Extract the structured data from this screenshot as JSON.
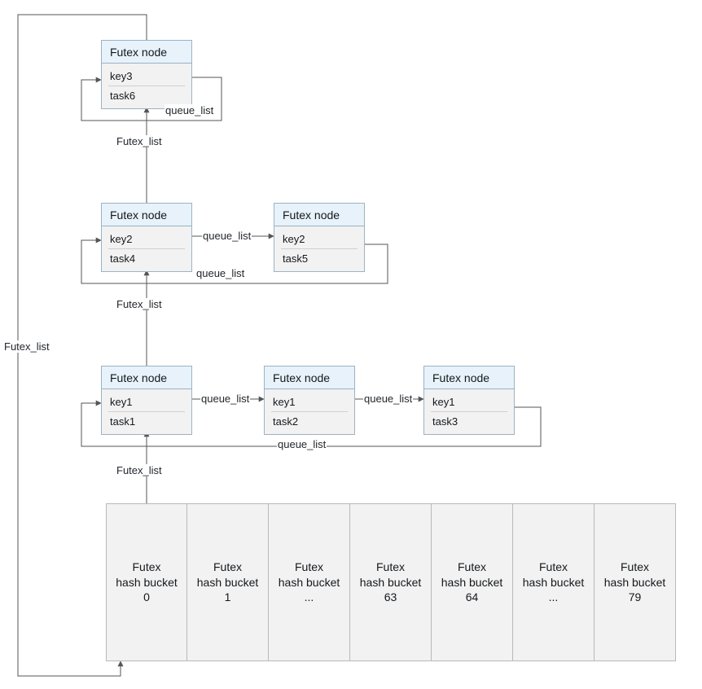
{
  "node_title": "Futex node",
  "nodes": {
    "n_k3_t6": {
      "key": "key3",
      "task": "task6"
    },
    "n_k2_t4": {
      "key": "key2",
      "task": "task4"
    },
    "n_k2_t5": {
      "key": "key2",
      "task": "task5"
    },
    "n_k1_t1": {
      "key": "key1",
      "task": "task1"
    },
    "n_k1_t2": {
      "key": "key1",
      "task": "task2"
    },
    "n_k1_t3": {
      "key": "key1",
      "task": "task3"
    }
  },
  "edge_labels": {
    "futex_list": "Futex_list",
    "queue_list": "queue_list"
  },
  "buckets": [
    {
      "label": "Futex\nhash bucket\n0"
    },
    {
      "label": "Futex\nhash bucket\n1"
    },
    {
      "label": "Futex\nhash bucket\n..."
    },
    {
      "label": "Futex\nhash bucket\n63"
    },
    {
      "label": "Futex\nhash bucket\n64"
    },
    {
      "label": "Futex\nhash bucket\n..."
    },
    {
      "label": "Futex\nhash bucket\n79"
    }
  ]
}
